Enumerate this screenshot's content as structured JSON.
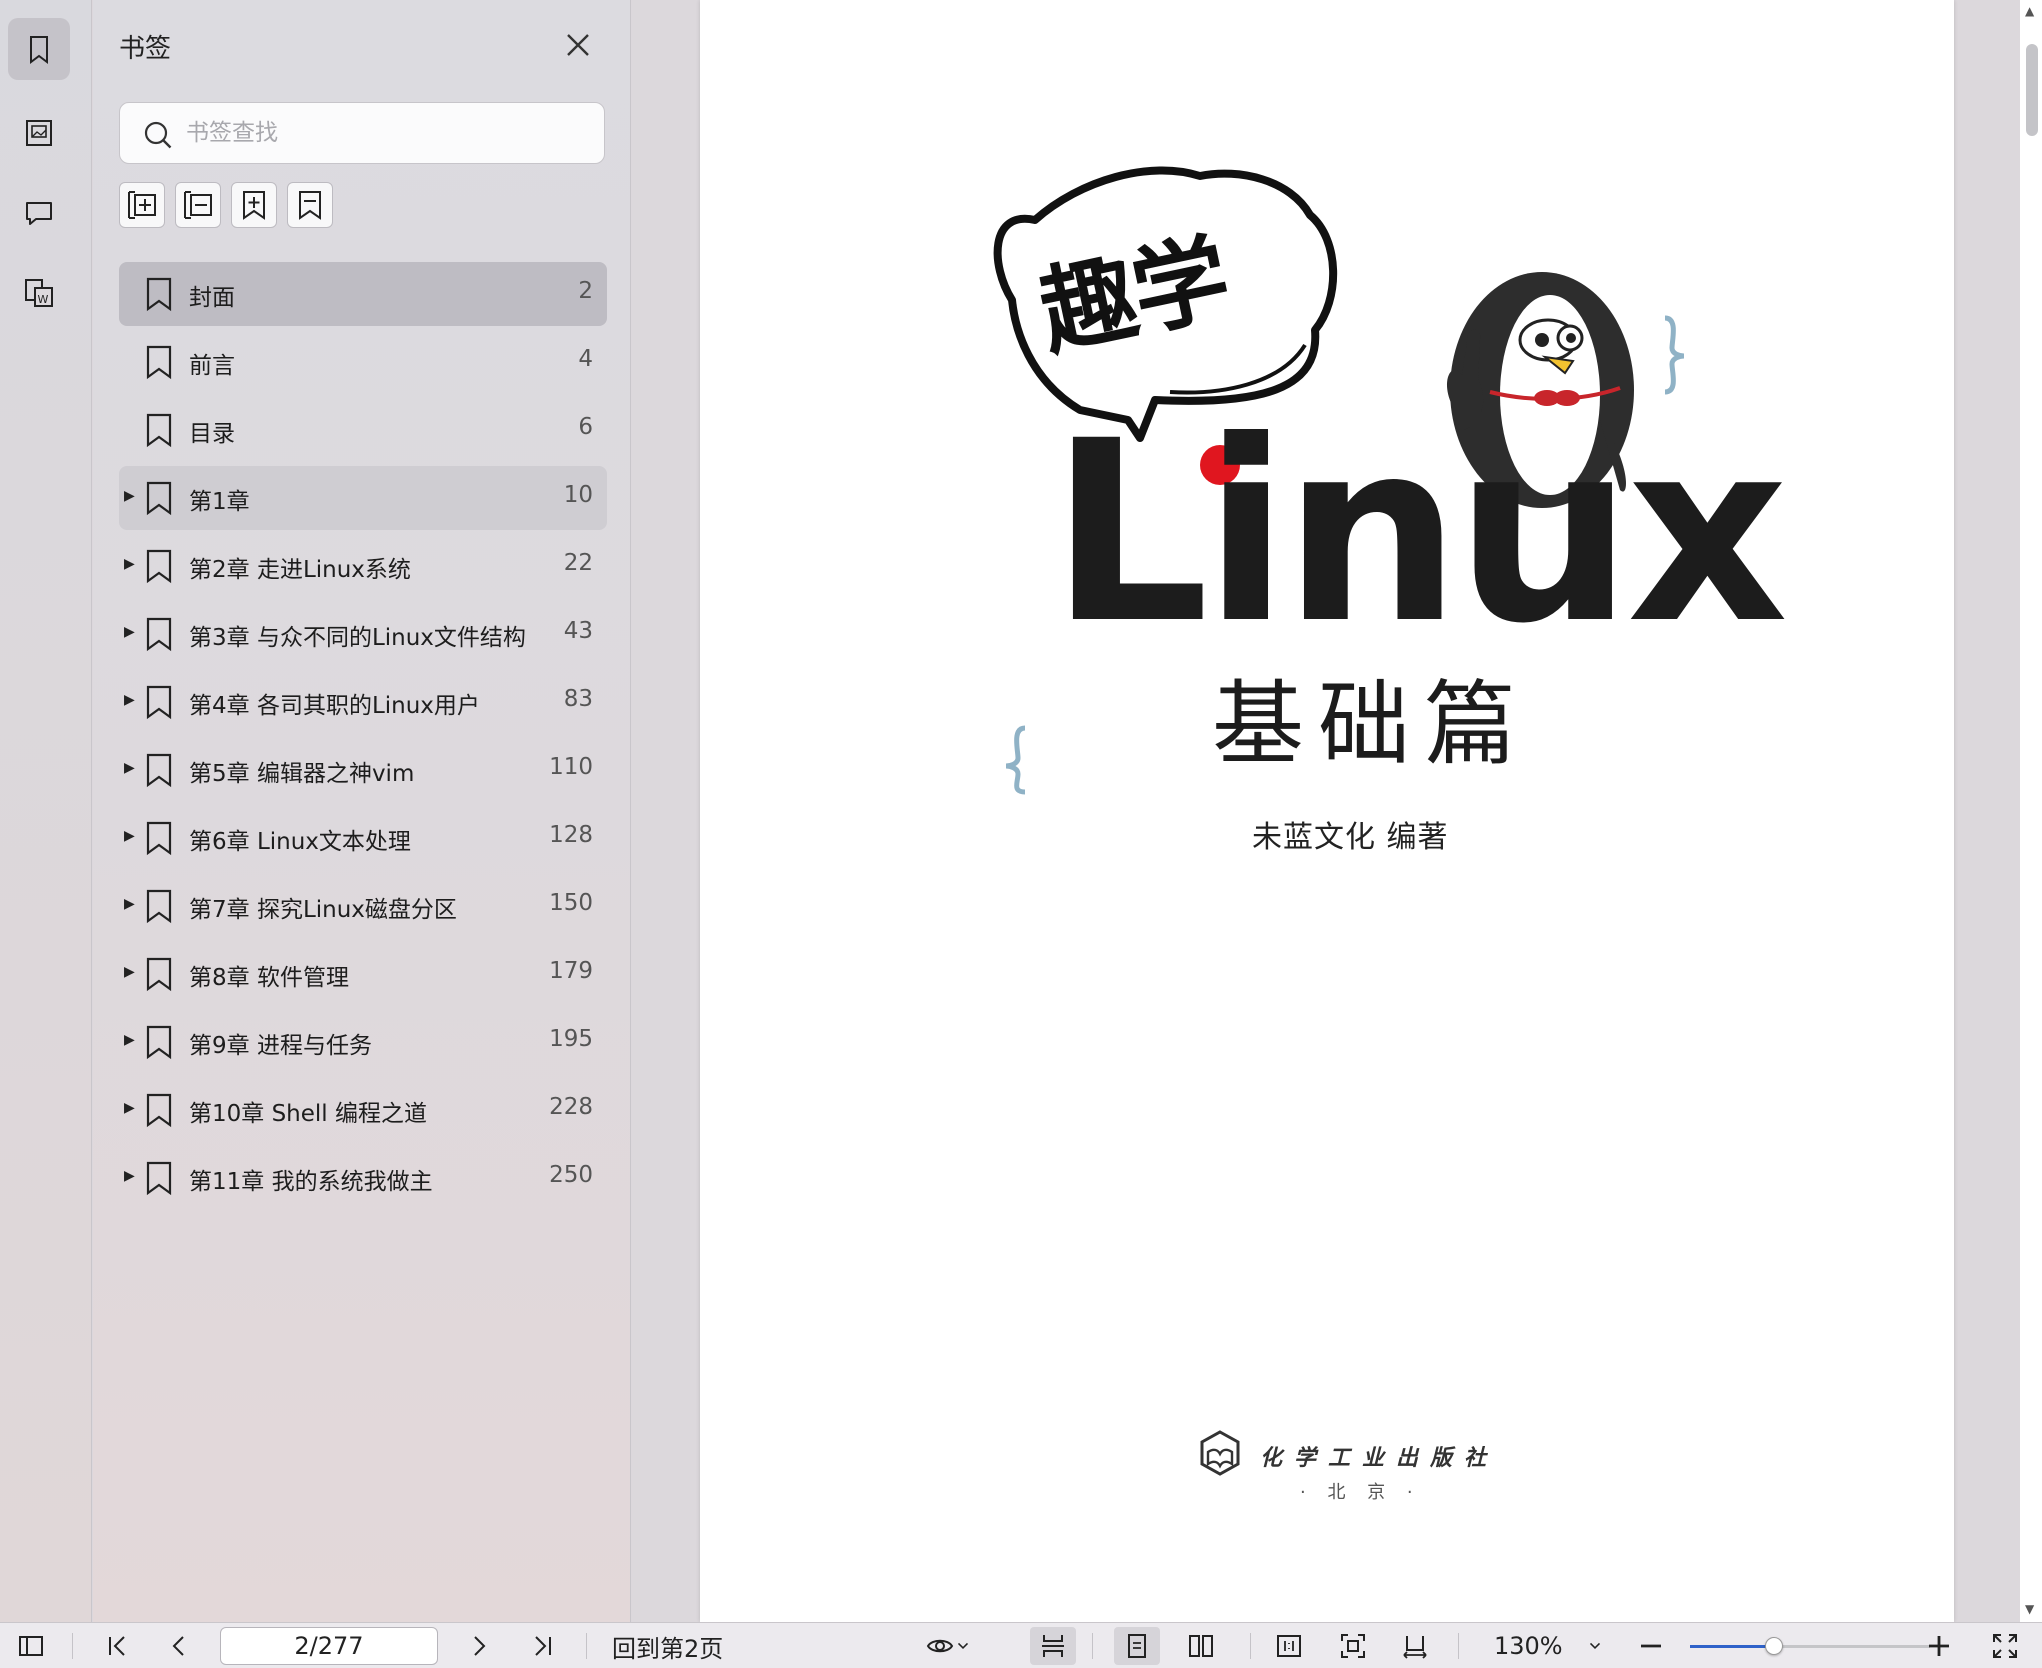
{
  "panel": {
    "title": "书签",
    "search_placeholder": "书签查找"
  },
  "bookmarks": [
    {
      "label": "封面",
      "page": "2",
      "expandable": false,
      "state": "selected"
    },
    {
      "label": "前言",
      "page": "4",
      "expandable": false,
      "state": ""
    },
    {
      "label": "目录",
      "page": "6",
      "expandable": false,
      "state": ""
    },
    {
      "label": "第1章",
      "page": "10",
      "expandable": true,
      "state": "hover"
    },
    {
      "label": "第2章 走进Linux系统",
      "page": "22",
      "expandable": true,
      "state": ""
    },
    {
      "label": "第3章 与众不同的Linux文件结构",
      "page": "43",
      "expandable": true,
      "state": ""
    },
    {
      "label": "第4章 各司其职的Linux用户",
      "page": "83",
      "expandable": true,
      "state": ""
    },
    {
      "label": "第5章 编辑器之神vim",
      "page": "110",
      "expandable": true,
      "state": ""
    },
    {
      "label": "第6章 Linux文本处理",
      "page": "128",
      "expandable": true,
      "state": ""
    },
    {
      "label": "第7章 探究Linux磁盘分区",
      "page": "150",
      "expandable": true,
      "state": ""
    },
    {
      "label": "第8章 软件管理",
      "page": "179",
      "expandable": true,
      "state": ""
    },
    {
      "label": "第9章 进程与任务",
      "page": "195",
      "expandable": true,
      "state": ""
    },
    {
      "label": "第10章 Shell 编程之道",
      "page": "228",
      "expandable": true,
      "state": ""
    },
    {
      "label": "第11章 我的系统我做主",
      "page": "250",
      "expandable": true,
      "state": ""
    }
  ],
  "cover": {
    "badge": "趣学",
    "title": "Linux",
    "subtitle": "基础篇",
    "author": "未蓝文化  编著",
    "publisher": "化学工业出版社",
    "city": "· 北 京 ·"
  },
  "toolbar": {
    "page_indicator": "2/277",
    "back_to_page": "回到第2页",
    "zoom": "130%",
    "zoom_level_fraction": 0.35
  },
  "colors": {
    "accent": "#2f62c9",
    "linux_dot": "#e0161f",
    "brace": "#8fb2c6"
  }
}
